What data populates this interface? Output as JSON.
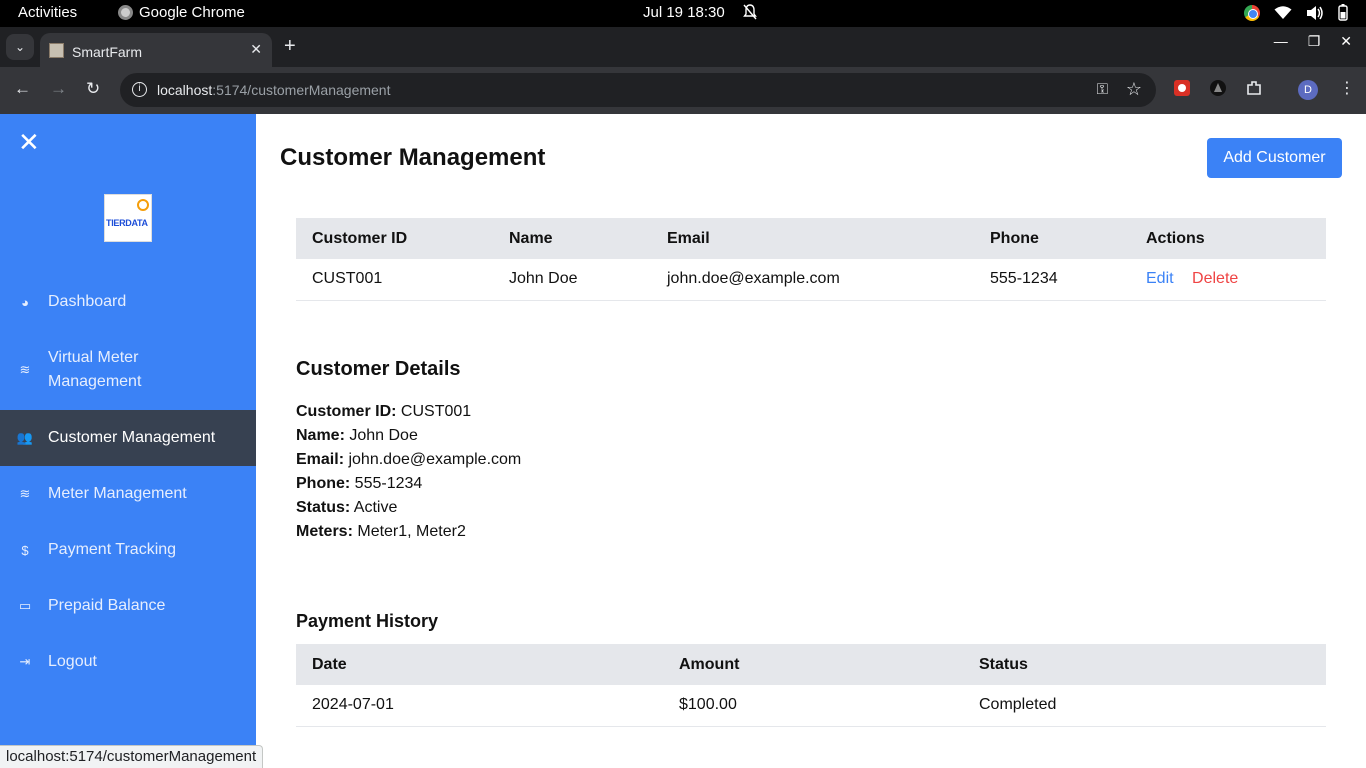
{
  "os": {
    "activities": "Activities",
    "app_name": "Google Chrome",
    "clock": "Jul 19  18:30"
  },
  "browser": {
    "tab_title": "SmartFarm",
    "url_host": "localhost",
    "url_path": ":5174/customerManagement",
    "profile_initial": "D",
    "status_url": "localhost:5174/customerManagement"
  },
  "sidebar": {
    "logo_text": "TIERDATA",
    "items": [
      {
        "label": "Dashboard",
        "icon": "gauge-icon"
      },
      {
        "label": "Virtual Meter Management",
        "icon": "water-icon"
      },
      {
        "label": "Customer Management",
        "icon": "users-icon"
      },
      {
        "label": "Meter Management",
        "icon": "water-icon"
      },
      {
        "label": "Payment Tracking",
        "icon": "dollar-icon"
      },
      {
        "label": "Prepaid Balance",
        "icon": "money-bill-icon"
      },
      {
        "label": "Logout",
        "icon": "logout-icon"
      }
    ]
  },
  "main": {
    "title": "Customer Management",
    "add_button": "Add Customer",
    "customers_table": {
      "headers": [
        "Customer ID",
        "Name",
        "Email",
        "Phone",
        "Actions"
      ],
      "rows": [
        {
          "id": "CUST001",
          "name": "John Doe",
          "email": "john.doe@example.com",
          "phone": "555-1234",
          "edit": "Edit",
          "delete": "Delete"
        }
      ]
    },
    "details": {
      "title": "Customer Details",
      "id_label": "Customer ID:",
      "id_value": "CUST001",
      "name_label": "Name:",
      "name_value": "John Doe",
      "email_label": "Email:",
      "email_value": "john.doe@example.com",
      "phone_label": "Phone:",
      "phone_value": "555-1234",
      "status_label": "Status:",
      "status_value": "Active",
      "meters_label": "Meters:",
      "meters_value": "Meter1, Meter2"
    },
    "payment_history": {
      "title": "Payment History",
      "headers": [
        "Date",
        "Amount",
        "Status"
      ],
      "rows": [
        {
          "date": "2024-07-01",
          "amount": "$100.00",
          "status": "Completed"
        }
      ]
    }
  }
}
